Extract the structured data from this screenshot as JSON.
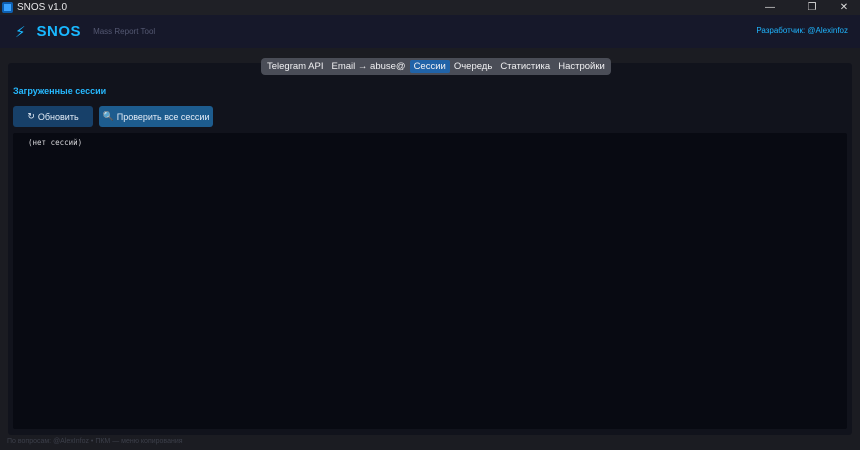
{
  "window": {
    "title": "SNOS v1.0",
    "controls": {
      "minimize": "—",
      "maximize": "❐",
      "close": "✕"
    }
  },
  "header": {
    "logo_icon": "bolt-icon",
    "logo_glyph": "⚡",
    "logo_text": "SNOS",
    "subtitle": "Mass Report Tool",
    "developer": "Разработчик: @Alexinfoz",
    "accent_color": "#19b8ff"
  },
  "tabs": [
    {
      "label": "Telegram API",
      "active": false
    },
    {
      "label": "Email → abuse@",
      "active": false
    },
    {
      "label": "Сессии",
      "active": true
    },
    {
      "label": "Очередь",
      "active": false
    },
    {
      "label": "Статистика",
      "active": false
    },
    {
      "label": "Настройки",
      "active": false
    }
  ],
  "sessions_panel": {
    "title": "Загруженные сессии",
    "refresh_button": "Обновить",
    "refresh_icon": "↻",
    "check_button": "Проверить все сессии",
    "check_icon": "🔍",
    "empty_text": "(нет сессий)"
  },
  "footer": {
    "text": "По вопросам: @AlexInfoz • ПКМ — меню копирования"
  }
}
